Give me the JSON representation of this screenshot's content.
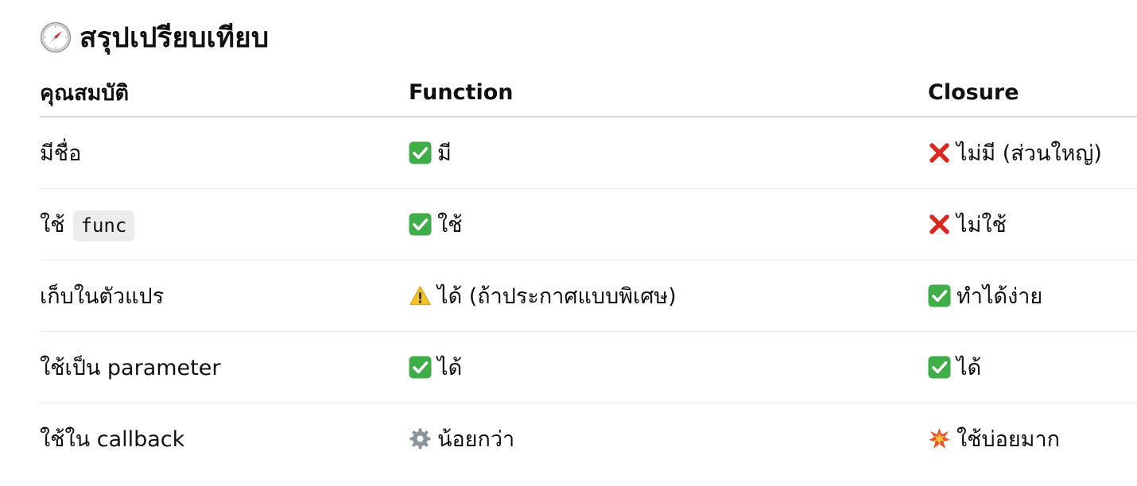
{
  "heading": {
    "icon": "compass-icon",
    "title": "สรุปเปรียบเทียบ"
  },
  "table": {
    "headers": [
      "คุณสมบัติ",
      "Function",
      "Closure"
    ],
    "rows": [
      {
        "property": "มีชื่อ",
        "property_code": "",
        "function": {
          "icon": "check-icon",
          "text": "มี"
        },
        "closure": {
          "icon": "cross-icon",
          "text": "ไม่มี (ส่วนใหญ่)"
        }
      },
      {
        "property": "ใช้",
        "property_code": "func",
        "function": {
          "icon": "check-icon",
          "text": "ใช้"
        },
        "closure": {
          "icon": "cross-icon",
          "text": "ไม่ใช้"
        }
      },
      {
        "property": "เก็บในตัวแปร",
        "property_code": "",
        "function": {
          "icon": "warning-icon",
          "text": "ได้ (ถ้าประกาศแบบพิเศษ)"
        },
        "closure": {
          "icon": "check-icon",
          "text": "ทำได้ง่าย"
        }
      },
      {
        "property": "ใช้เป็น parameter",
        "property_code": "",
        "function": {
          "icon": "check-icon",
          "text": "ได้"
        },
        "closure": {
          "icon": "check-icon",
          "text": "ได้"
        }
      },
      {
        "property": "ใช้ใน callback",
        "property_code": "",
        "function": {
          "icon": "gear-icon",
          "text": "น้อยกว่า"
        },
        "closure": {
          "icon": "collision-icon",
          "text": "ใช้บ่อยมาก"
        }
      }
    ]
  },
  "colors": {
    "check": "#3fae49",
    "cross": "#d9281f",
    "warning": "#f5c32c",
    "gear": "#8a949c",
    "collision": "#e8542c"
  }
}
